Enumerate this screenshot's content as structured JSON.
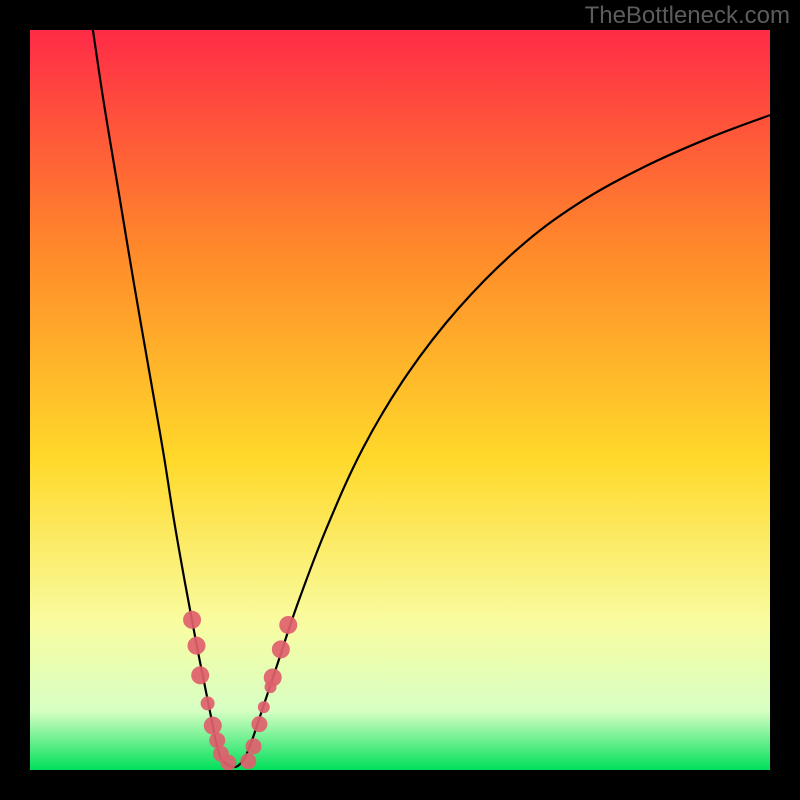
{
  "watermark": "TheBottleneck.com",
  "colors": {
    "background": "#000000",
    "watermark": "#5c5c5c",
    "gradient_top": "#ff2b47",
    "gradient_mid1": "#ff8a2a",
    "gradient_mid2": "#ffd92a",
    "gradient_mid3": "#f9fca0",
    "gradient_mid4": "#d7ffc4",
    "gradient_bottom": "#00e05a",
    "curve": "#000000",
    "marker_fill": "#e0606c",
    "marker_stroke": "#e0606c"
  },
  "chart_data": {
    "type": "line",
    "title": "",
    "xlabel": "",
    "ylabel": "",
    "xlim": [
      0,
      1
    ],
    "ylim": [
      0,
      1
    ],
    "curve_left": {
      "name": "left-branch",
      "x": [
        0.085,
        0.1,
        0.12,
        0.14,
        0.16,
        0.18,
        0.195,
        0.21,
        0.225,
        0.235,
        0.245,
        0.252,
        0.258
      ],
      "y": [
        1.0,
        0.9,
        0.78,
        0.66,
        0.545,
        0.43,
        0.335,
        0.25,
        0.17,
        0.12,
        0.07,
        0.035,
        0.015
      ]
    },
    "curve_right": {
      "name": "right-branch",
      "x": [
        0.29,
        0.3,
        0.315,
        0.335,
        0.36,
        0.4,
        0.45,
        0.51,
        0.58,
        0.66,
        0.74,
        0.83,
        0.92,
        1.0
      ],
      "y": [
        0.015,
        0.04,
        0.085,
        0.145,
        0.22,
        0.325,
        0.435,
        0.535,
        0.625,
        0.705,
        0.765,
        0.815,
        0.855,
        0.885
      ]
    },
    "curve_bottom": {
      "name": "flat-bottom",
      "x": [
        0.258,
        0.27,
        0.28,
        0.29
      ],
      "y": [
        0.015,
        0.005,
        0.005,
        0.015
      ]
    },
    "markers_left": [
      {
        "x": 0.219,
        "y": 0.203,
        "r": 9
      },
      {
        "x": 0.225,
        "y": 0.168,
        "r": 9
      },
      {
        "x": 0.23,
        "y": 0.128,
        "r": 9
      },
      {
        "x": 0.24,
        "y": 0.09,
        "r": 7
      },
      {
        "x": 0.247,
        "y": 0.06,
        "r": 9
      },
      {
        "x": 0.253,
        "y": 0.04,
        "r": 8
      },
      {
        "x": 0.258,
        "y": 0.022,
        "r": 8
      },
      {
        "x": 0.268,
        "y": 0.01,
        "r": 8
      }
    ],
    "markers_right": [
      {
        "x": 0.295,
        "y": 0.012,
        "r": 8
      },
      {
        "x": 0.302,
        "y": 0.032,
        "r": 8
      },
      {
        "x": 0.31,
        "y": 0.062,
        "r": 8
      },
      {
        "x": 0.316,
        "y": 0.085,
        "r": 6
      },
      {
        "x": 0.328,
        "y": 0.125,
        "r": 9
      },
      {
        "x": 0.339,
        "y": 0.163,
        "r": 9
      },
      {
        "x": 0.349,
        "y": 0.196,
        "r": 9
      },
      {
        "x": 0.325,
        "y": 0.112,
        "r": 6
      }
    ]
  }
}
